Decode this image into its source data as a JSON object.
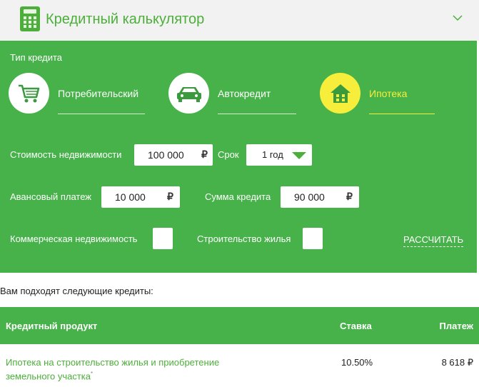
{
  "header": {
    "title": "Кредитный калькулятор",
    "icon": "calculator-icon",
    "toggle_icon": "chevron-down-icon"
  },
  "colors": {
    "green": "#47b24a",
    "brand_green": "#4caf3a",
    "active_yellow": "#f7ee3c"
  },
  "credit_type": {
    "label": "Тип кредита",
    "options": [
      {
        "label": "Потребительский",
        "icon": "shopping-cart-icon",
        "active": false
      },
      {
        "label": "Автокредит",
        "icon": "car-icon",
        "active": false
      },
      {
        "label": "Ипотека",
        "icon": "house-icon",
        "active": true
      }
    ]
  },
  "form": {
    "property_cost": {
      "label": "Стоимость недвижимости",
      "value": "100 000",
      "currency": "₽"
    },
    "term": {
      "label": "Срок",
      "value": "1 год"
    },
    "down_payment": {
      "label": "Авансовый платеж",
      "value": "10 000",
      "currency": "₽"
    },
    "loan_amount": {
      "label": "Сумма кредита",
      "value": "90 000",
      "currency": "₽"
    },
    "commercial": {
      "label": "Коммерческая недвижимость",
      "checked": false
    },
    "construction": {
      "label": "Строительство жилья",
      "checked": false
    },
    "calculate_label": "РАССЧИТАТЬ"
  },
  "results": {
    "intro": "Вам подходят следующие кредиты:",
    "headers": {
      "product": "Кредитный продукт",
      "rate": "Ставка",
      "payment": "Платеж"
    },
    "rows": [
      {
        "product": "Ипотека на строительство жилья и приобретение земельного участка",
        "footnote": "*",
        "rate": "10.50%",
        "payment": "8 618 ₽"
      }
    ]
  }
}
